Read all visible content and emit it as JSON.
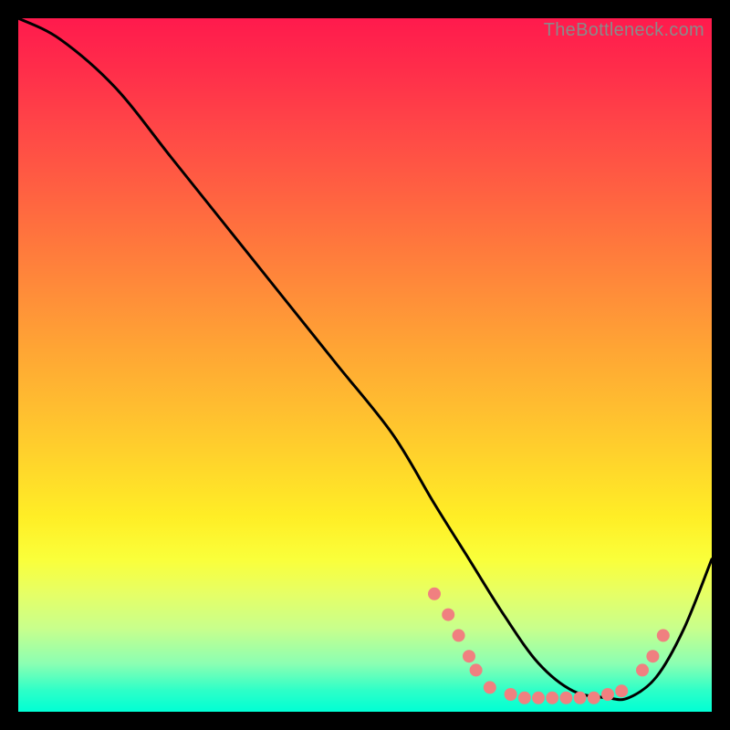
{
  "watermark": "TheBottleneck.com",
  "chart_data": {
    "type": "line",
    "title": "",
    "xlabel": "",
    "ylabel": "",
    "xlim": [
      0,
      100
    ],
    "ylim": [
      0,
      100
    ],
    "series": [
      {
        "name": "curve",
        "x": [
          0,
          6,
          14,
          22,
          30,
          38,
          46,
          54,
          60,
          65,
          70,
          75,
          80,
          85,
          88,
          92,
          96,
          100
        ],
        "y": [
          100,
          97,
          90,
          80,
          70,
          60,
          50,
          40,
          30,
          22,
          14,
          7,
          3,
          2,
          2,
          5,
          12,
          22
        ]
      }
    ],
    "markers": {
      "name": "dots",
      "color": "#f08080",
      "radius": 7,
      "points": [
        {
          "x": 60,
          "y": 17
        },
        {
          "x": 62,
          "y": 14
        },
        {
          "x": 63.5,
          "y": 11
        },
        {
          "x": 65,
          "y": 8
        },
        {
          "x": 66,
          "y": 6
        },
        {
          "x": 68,
          "y": 3.5
        },
        {
          "x": 71,
          "y": 2.5
        },
        {
          "x": 73,
          "y": 2
        },
        {
          "x": 75,
          "y": 2
        },
        {
          "x": 77,
          "y": 2
        },
        {
          "x": 79,
          "y": 2
        },
        {
          "x": 81,
          "y": 2
        },
        {
          "x": 83,
          "y": 2
        },
        {
          "x": 85,
          "y": 2.5
        },
        {
          "x": 87,
          "y": 3
        },
        {
          "x": 90,
          "y": 6
        },
        {
          "x": 91.5,
          "y": 8
        },
        {
          "x": 93,
          "y": 11
        }
      ]
    }
  }
}
